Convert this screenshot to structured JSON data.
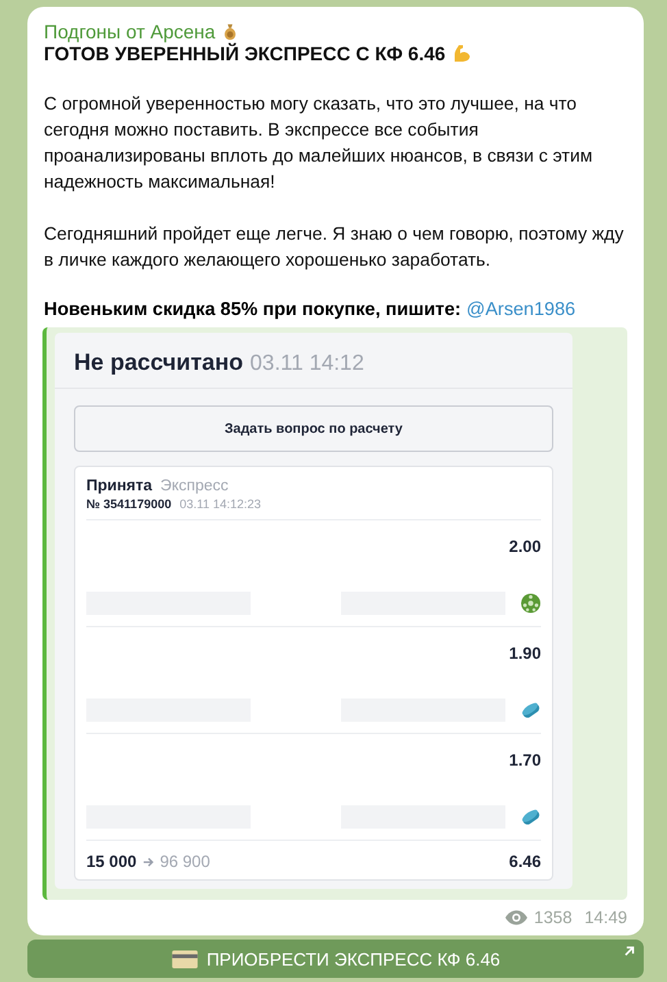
{
  "channel_name": "Подгоны от Арсена",
  "headline": "ГОТОВ УВЕРЕННЫЙ ЭКСПРЕСС С КФ 6.46",
  "paragraphs": [
    "С огромной уверенностью могу сказать, что это лучшее, на что сегодня можно поставить. В экспрессе все события проанализированы вплоть до малейших нюансов, в связи с этим надежность максимальная!",
    "Сегодняшний пройдет еще легче. Я знаю о чем говорю, поэтому жду в личке каждого желающего хорошенько заработать."
  ],
  "promo": {
    "text": "Новеньким скидка 85% при покупке, пишите:",
    "link": "@Arsen1986"
  },
  "slip": {
    "status": "Не рассчитано",
    "date": "03.11 14:12",
    "ask_button": "Задать вопрос по расчету",
    "bet_status": "Принята",
    "bet_type": "Экспресс",
    "bet_number": "№ 3541179000",
    "bet_time": "03.11  14:12:23",
    "events": [
      {
        "odds": "2.00",
        "kind": "soccer"
      },
      {
        "odds": "1.90",
        "kind": "hockey"
      },
      {
        "odds": "1.70",
        "kind": "hockey"
      }
    ],
    "stake": "15 000",
    "payout": "96 900",
    "total_odds": "6.46"
  },
  "meta": {
    "views": "1358",
    "time": "14:49"
  },
  "action_button": "ПРИОБРЕСТИ ЭКСПРЕСС КФ 6.46"
}
